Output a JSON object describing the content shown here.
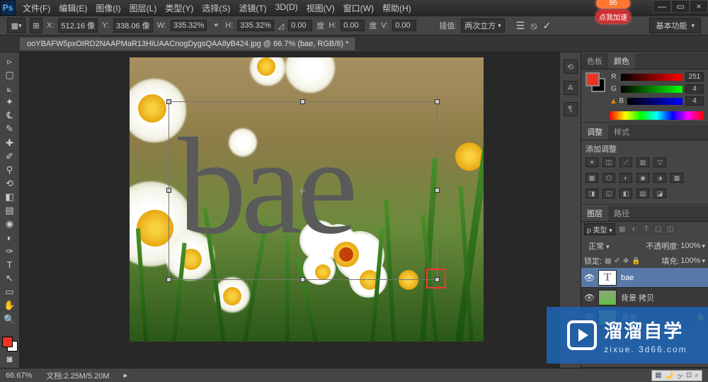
{
  "menubar": {
    "file": "文件(F)",
    "edit": "编辑(E)",
    "image": "图像(I)",
    "layer": "图层(L)",
    "type": "类型(Y)",
    "select": "选择(S)",
    "filter": "滤镜(T)",
    "threed": "3D(D)",
    "view": "视图(V)",
    "window": "窗口(W)",
    "help": "帮助(H)"
  },
  "promo": {
    "num": "86",
    "label": "点我加速"
  },
  "options": {
    "x_label": "X:",
    "x_val": "512.16 像",
    "y_label": "Y:",
    "y_val": "338.06 像",
    "w_label": "W:",
    "w_val": "335.32%",
    "h_label": "H:",
    "h_val": "335.32%",
    "rot_val": "0.00",
    "rot_unit": "度",
    "hskew_label": "H:",
    "hskew_val": "0.00",
    "hskew_unit": "度",
    "vskew_label": "V:",
    "vskew_val": "0.00",
    "interp_label": "插值:",
    "interp_val": "两次立方",
    "workspace": "基本功能"
  },
  "tab": {
    "title": "ooYBAFW5pxOIRD2NAAPMaR13HiUAACnogDygsQAA8yB424.jpg @ 66.7% (bae, RGB/8) *"
  },
  "canvas": {
    "text": "bae"
  },
  "panels": {
    "color_tab": "色板",
    "swatch_tab": "颜色",
    "r_label": "R",
    "g_label": "G",
    "b_label": "B",
    "r_val": "251",
    "g_val": "4",
    "b_val": "4",
    "adjust_tab": "调整",
    "style_tab": "样式",
    "adjust_add": "添加调整",
    "layers_tab": "图层",
    "paths_tab": "路径",
    "kind_label": "ρ 类型",
    "blend_normal": "正常",
    "opacity_label": "不透明度:",
    "opacity_val": "100%",
    "lock_label": "锁定:",
    "fill_label": "填充:",
    "fill_val": "100%",
    "layer1_name": "bae",
    "layer2_name": "背景 拷贝",
    "layer3_name": "背景"
  },
  "status": {
    "zoom": "66.67%",
    "doc": "文档:2.25M/5.20M"
  },
  "watermark": {
    "title": "溜溜自学",
    "sub": "zixue. 3d66.com"
  }
}
